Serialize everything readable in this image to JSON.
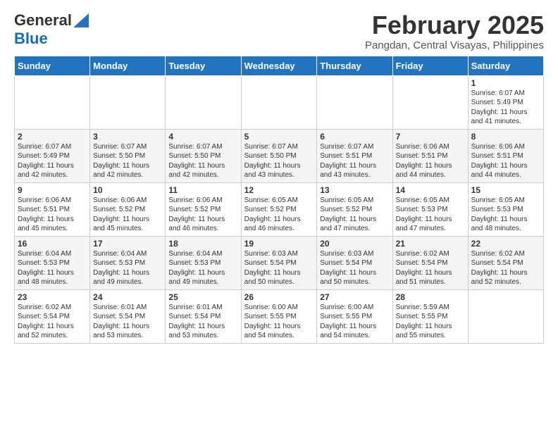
{
  "header": {
    "logo_general": "General",
    "logo_blue": "Blue",
    "month_title": "February 2025",
    "subtitle": "Pangdan, Central Visayas, Philippines"
  },
  "weekdays": [
    "Sunday",
    "Monday",
    "Tuesday",
    "Wednesday",
    "Thursday",
    "Friday",
    "Saturday"
  ],
  "weeks": [
    [
      {
        "day": "",
        "info": ""
      },
      {
        "day": "",
        "info": ""
      },
      {
        "day": "",
        "info": ""
      },
      {
        "day": "",
        "info": ""
      },
      {
        "day": "",
        "info": ""
      },
      {
        "day": "",
        "info": ""
      },
      {
        "day": "1",
        "info": "Sunrise: 6:07 AM\nSunset: 5:49 PM\nDaylight: 11 hours and 41 minutes."
      }
    ],
    [
      {
        "day": "2",
        "info": "Sunrise: 6:07 AM\nSunset: 5:49 PM\nDaylight: 11 hours and 42 minutes."
      },
      {
        "day": "3",
        "info": "Sunrise: 6:07 AM\nSunset: 5:50 PM\nDaylight: 11 hours and 42 minutes."
      },
      {
        "day": "4",
        "info": "Sunrise: 6:07 AM\nSunset: 5:50 PM\nDaylight: 11 hours and 42 minutes."
      },
      {
        "day": "5",
        "info": "Sunrise: 6:07 AM\nSunset: 5:50 PM\nDaylight: 11 hours and 43 minutes."
      },
      {
        "day": "6",
        "info": "Sunrise: 6:07 AM\nSunset: 5:51 PM\nDaylight: 11 hours and 43 minutes."
      },
      {
        "day": "7",
        "info": "Sunrise: 6:06 AM\nSunset: 5:51 PM\nDaylight: 11 hours and 44 minutes."
      },
      {
        "day": "8",
        "info": "Sunrise: 6:06 AM\nSunset: 5:51 PM\nDaylight: 11 hours and 44 minutes."
      }
    ],
    [
      {
        "day": "9",
        "info": "Sunrise: 6:06 AM\nSunset: 5:51 PM\nDaylight: 11 hours and 45 minutes."
      },
      {
        "day": "10",
        "info": "Sunrise: 6:06 AM\nSunset: 5:52 PM\nDaylight: 11 hours and 45 minutes."
      },
      {
        "day": "11",
        "info": "Sunrise: 6:06 AM\nSunset: 5:52 PM\nDaylight: 11 hours and 46 minutes."
      },
      {
        "day": "12",
        "info": "Sunrise: 6:05 AM\nSunset: 5:52 PM\nDaylight: 11 hours and 46 minutes."
      },
      {
        "day": "13",
        "info": "Sunrise: 6:05 AM\nSunset: 5:52 PM\nDaylight: 11 hours and 47 minutes."
      },
      {
        "day": "14",
        "info": "Sunrise: 6:05 AM\nSunset: 5:53 PM\nDaylight: 11 hours and 47 minutes."
      },
      {
        "day": "15",
        "info": "Sunrise: 6:05 AM\nSunset: 5:53 PM\nDaylight: 11 hours and 48 minutes."
      }
    ],
    [
      {
        "day": "16",
        "info": "Sunrise: 6:04 AM\nSunset: 5:53 PM\nDaylight: 11 hours and 48 minutes."
      },
      {
        "day": "17",
        "info": "Sunrise: 6:04 AM\nSunset: 5:53 PM\nDaylight: 11 hours and 49 minutes."
      },
      {
        "day": "18",
        "info": "Sunrise: 6:04 AM\nSunset: 5:53 PM\nDaylight: 11 hours and 49 minutes."
      },
      {
        "day": "19",
        "info": "Sunrise: 6:03 AM\nSunset: 5:54 PM\nDaylight: 11 hours and 50 minutes."
      },
      {
        "day": "20",
        "info": "Sunrise: 6:03 AM\nSunset: 5:54 PM\nDaylight: 11 hours and 50 minutes."
      },
      {
        "day": "21",
        "info": "Sunrise: 6:02 AM\nSunset: 5:54 PM\nDaylight: 11 hours and 51 minutes."
      },
      {
        "day": "22",
        "info": "Sunrise: 6:02 AM\nSunset: 5:54 PM\nDaylight: 11 hours and 52 minutes."
      }
    ],
    [
      {
        "day": "23",
        "info": "Sunrise: 6:02 AM\nSunset: 5:54 PM\nDaylight: 11 hours and 52 minutes."
      },
      {
        "day": "24",
        "info": "Sunrise: 6:01 AM\nSunset: 5:54 PM\nDaylight: 11 hours and 53 minutes."
      },
      {
        "day": "25",
        "info": "Sunrise: 6:01 AM\nSunset: 5:54 PM\nDaylight: 11 hours and 53 minutes."
      },
      {
        "day": "26",
        "info": "Sunrise: 6:00 AM\nSunset: 5:55 PM\nDaylight: 11 hours and 54 minutes."
      },
      {
        "day": "27",
        "info": "Sunrise: 6:00 AM\nSunset: 5:55 PM\nDaylight: 11 hours and 54 minutes."
      },
      {
        "day": "28",
        "info": "Sunrise: 5:59 AM\nSunset: 5:55 PM\nDaylight: 11 hours and 55 minutes."
      },
      {
        "day": "",
        "info": ""
      }
    ]
  ]
}
